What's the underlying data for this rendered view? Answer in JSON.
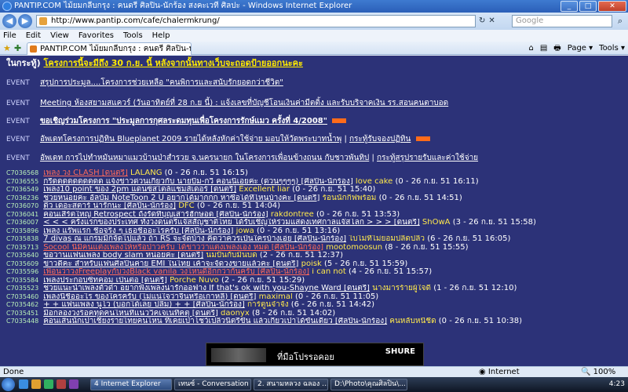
{
  "window": {
    "title": "PANTIP.COM ไม้ยมกลีบกรุง : คนดรี ศิลปิน-นักร้อง สงคะเวที ศิลปะ - Windows Internet Explorer",
    "minimize": "_",
    "maximize": "□",
    "close": "✕"
  },
  "address": {
    "back": "◀",
    "forward": "▶",
    "url": "http://www.pantip.com/cafe/chalermkrung/",
    "refresh": "↻",
    "stop": "✕",
    "search_placeholder": "Google",
    "search_go": "⌕"
  },
  "menu": [
    "File",
    "Edit",
    "View",
    "Favorites",
    "Tools",
    "Help"
  ],
  "tab": {
    "label": "PANTIP.COM ไม้ยมกลีบกรุง : คนดรี ศิลปิน-นักร้อง ..."
  },
  "commands": [
    "⌂",
    "▤",
    "🖶",
    "Page ▾",
    "Tools ▾"
  ],
  "announcement": {
    "prefix": "ในกระทู้)",
    "text": "โครงการนี้จะมีถึง 30 ก.ย. นี้ หลังจากนั้นทางเว็บจะถอดป้ายออกนะคะ"
  },
  "events": [
    {
      "tag": "EVENT",
      "links": [
        "สรุปการประมูล....โครงการช่วยเหลือ \"คนพิการและสนับรักยอดกว่าชีวิต\""
      ],
      "flag": false
    },
    {
      "tag": "EVENT",
      "links": [
        "Meeting ห้องสยามสแควร์ (วันอาทิตย์ที่ 28 ก.ย นี้) : แจ้งเลขที่บัญชีโอนเงินค่ามีตติ้ง และรับบริจาคเงิน รร.สอนคนตาบอด"
      ],
      "flag": false
    },
    {
      "tag": "EVENT",
      "links": [
        "ขอเชิญร่วมโครงการ \"ประมูลการกุศลระดมทุนเพื่อโครงการรักษ์แมว ครั้งที่ 4/2008\""
      ],
      "flag": true
    },
    {
      "tag": "EVENT",
      "links": [
        "อัพเดทโครงการปฏิทิน Blueplanet 2009 รายได้หลังหักค่าใช้จ่าย มอบให้วัดพระบาทน้ำพุ",
        "กระทู้รับจองปฏิทิน"
      ],
      "flag": true
    },
    {
      "tag": "EVENT",
      "links": [
        "อัพเดท การไปทำหมันหมาแมวบ้านป่าสำรวย จ.นครนายก ในโครงการเพื่อนข้างถนน กับชาวพันทิป",
        "กระทู้สรุปรายรับและค่าใช้จ่าย"
      ],
      "flag": false
    }
  ],
  "threads": [
    {
      "id": "C7036568",
      "title": "เพลง วง CLASH [ดนตรี]",
      "red": true,
      "author": "LALANG",
      "meta": "(0 - 26 ก.ย. 51 16:15)"
    },
    {
      "id": "C7036555",
      "title": "กรี๊ดดดดดดดดดด แจ้งข่าวด่วนเกี่ยวกับ นายบีม-กวี คอนนี่เอยค่ะ (ด่วนๆๆๆๆ) [ศิลปิน-นักร้อง]",
      "red": false,
      "author": "love cake",
      "meta": "(0 - 26 ก.ย. 51 16:11)"
    },
    {
      "id": "C7036549",
      "title": "เพลง10 point ของ 2pm แดนซ์สไตล์แชมส์เดอร์ [ดนตรี]",
      "red": false,
      "author": "Excellent liar",
      "meta": "(0 - 26 ก.ย. 51 15:40)"
    },
    {
      "id": "C7036236",
      "title": "ช่วยหน่อยค่ะ อัลบั้ม NoteToon 2 U อยากได้มากกก หาซื้อได้ที่ไหนบ้างคะ [ดนตรี]",
      "red": false,
      "author": "ร้อนนักกิ๊ฟพร้อม",
      "meta": "(0 - 26 ก.ย. 51 14:51)"
    },
    {
      "id": "C7036070",
      "title": "ดิว เดอะสตาร์ น่ารักนะ [ศิลปิน-นักร้อง]",
      "red": false,
      "author": "DFC",
      "meta": "(0 - 26 ก.ย. 51 14:04)"
    },
    {
      "id": "C7036041",
      "title": "คอนเสิร์ตใหญ่ Retrospect ถังรัดที่บุญเสาร์ฮักษอด [ศิลปิน-นักร้อง]",
      "red": false,
      "author": "rakdontree",
      "meta": "(0 - 26 ก.ย. 51 13:53)"
    },
    {
      "id": "C7036007",
      "title": "< < < ครั้งแรกของประเทศ ทั้งวงดนตรีแจ๊สสัญชาติไทย ได้รับเชิญให้ร่วมแสดงเทศกาลแจ๊สโลก > > > [ดนตรี]",
      "red": false,
      "author": "ShOwA",
      "meta": "(3 - 26 ก.ย. 51 15:58)"
    },
    {
      "id": "C7035896",
      "title": "เพลง แร๊พแรก ชื่อจริง ๆ เธอชื่ออะไรครับ [ศิลปิน-นักร้อง]",
      "red": false,
      "author": "jowa",
      "meta": "(0 - 26 ก.ย. 51 13:16)"
    },
    {
      "id": "C7035838",
      "title": "7 divas ณ แกรมมี่ก็จัดไปแล้ว ถ้า RS จะจัดบ้าง คิดว่าควรเป็นใครบ้างเอ่ย [ศิลปิน-นักร้อง]",
      "red": false,
      "author": "ไบไม่ที่ไม่ยอมปลิดปลิว",
      "meta": "(6 - 26 ก.ย. 51 16:05)"
    },
    {
      "id": "C7035713",
      "title": "Socool นี่มีคนแต่งเพลงให้หรือป่าวครับ ได้ข่าวว่าแต่งเพลงเอง หมด [ศิลปิน-นักร้อง]",
      "red": true,
      "author": "mootomoosun",
      "meta": "(8 - 26 ก.ย. 51 15:55)"
    },
    {
      "id": "C7035640",
      "title": "ขอวานแฟนเพลง body slam หน่อยค่ะ [ดนตรี]",
      "red": false,
      "author": "นมปั่นกับมิ้นบด",
      "meta": "(2 - 26 ก.ย. 51 12:37)"
    },
    {
      "id": "C7035609",
      "title": "ข่าวดีคะ สำหรับแฟนศิลปินค่าย EMI ในไทย เค้าจะจัดวงขายแล้วคะ [ดนตรี]",
      "red": false,
      "author": "poisk",
      "meta": "(5 - 26 ก.ย. 51 15:59)"
    },
    {
      "id": "C7035596",
      "title": "เพื่อนว่าวงFreeplayกับวงBlack vanila วงไหนดีอีกกว่ากันครับ [ศิลปิน-นักร้อง]",
      "red": true,
      "author": "i can not",
      "meta": "(4 - 26 ก.ย. 51 15:57)"
    },
    {
      "id": "C7035584",
      "title": "เพลงประกอบซิทคอม เป็นต่อ [ดนตรี]",
      "red": false,
      "author": "Porche Nuvo",
      "meta": "(2 - 26 ก.ย. 51 15:29)"
    },
    {
      "id": "C7035523",
      "title": "ช่วยแนะนำเพลงตัวดำ อยากฟังเพลงน่ารักออฟ่าง If that's ok with you-Shayne Ward [ดนตรี]",
      "red": false,
      "author": "นางมารร้ายผู้ใจดี",
      "meta": "(1 - 26 ก.ย. 51 12:10)"
    },
    {
      "id": "C7035460",
      "title": "เพลงนี้ชื่ออะไร ของใครครับ (ไม่แน่ใจว่าจีนหรือเกาหลี) [ดนตรี]",
      "red": false,
      "author": "maximal",
      "meta": "(0 - 26 ก.ย. 51 11:05)"
    },
    {
      "id": "C7035462",
      "title": "+ + แฟนเพลง นูโว (บอกได้เลย ปลื้ม) + + [ศิลปิน-นักร้อง]",
      "red": false,
      "author": "การ์ตูนจำจัง",
      "meta": "(6 - 26 ก.ย. 51 14:42)"
    },
    {
      "id": "C7035451",
      "title": "มีอกลองวงร็อคทุดคนไหนที่แนววิคเจเนทีคตุ [ดนตรี]",
      "red": false,
      "author": "daonyx",
      "meta": "(8 - 26 ก.ย. 51 14:02)"
    },
    {
      "id": "C7035448",
      "title": "คอนเส็นนักเปาเชียงรายไทยคนไหน ที่เคยเป่าโชว์เปลิวนี้ตรีขึ้น แล้วเกียวเป่าได้ขั้นเดี่ยว [ศิลปิน-นักร้อง]",
      "red": false,
      "author": "คนหลับหนีชีด",
      "meta": "(0 - 26 ก.ย. 51 10:38)"
    }
  ],
  "banner": {
    "text": "ที่มือโปรรอคอย",
    "brand": "SHURE"
  },
  "status": {
    "left": "Done",
    "zone": "Internet",
    "zoom": "100%"
  },
  "taskbar": {
    "tasks": [
      "4 Internet Explorer",
      "เทนซ์ - Conversation",
      "2. สนามหลวง ฉลอง ...",
      "D:\\Photo\\คุณศิลปิน\\..."
    ],
    "tray_time": "4:23"
  },
  "colors": {
    "page_bg": "#2c3278",
    "author": "#ffe94d",
    "red_title": "#ff6a5a",
    "flag": "#ff6b1a"
  }
}
